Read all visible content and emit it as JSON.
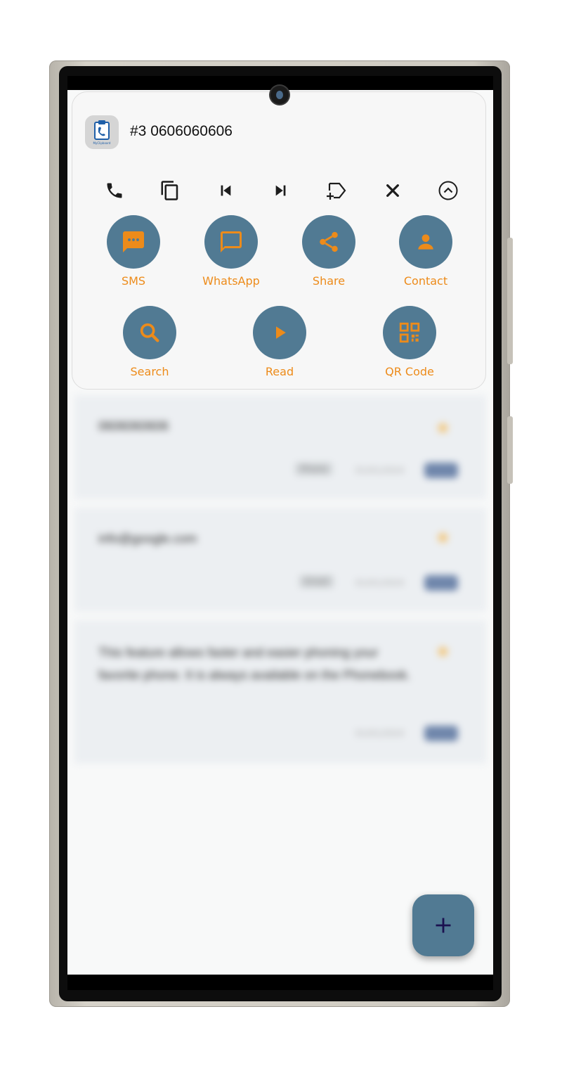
{
  "app": {
    "icon_label": "MyClipboard"
  },
  "header": {
    "title": "#3 0606060606"
  },
  "toolbar": [
    {
      "icon": "phone-icon"
    },
    {
      "icon": "copy-icon"
    },
    {
      "icon": "skip-previous-icon"
    },
    {
      "icon": "skip-next-icon"
    },
    {
      "icon": "add-label-icon"
    },
    {
      "icon": "close-icon"
    },
    {
      "icon": "collapse-up-icon"
    }
  ],
  "actions_row1": [
    {
      "label": "SMS",
      "icon": "sms-icon"
    },
    {
      "label": "WhatsApp",
      "icon": "chat-bubble-icon"
    },
    {
      "label": "Share",
      "icon": "share-icon"
    },
    {
      "label": "Contact",
      "icon": "person-icon"
    }
  ],
  "actions_row2": [
    {
      "label": "Search",
      "icon": "search-icon"
    },
    {
      "label": "Read",
      "icon": "play-icon"
    },
    {
      "label": "QR Code",
      "icon": "qr-code-icon"
    }
  ],
  "list": [
    {
      "text": "0606060606",
      "chip": "Phone",
      "date": "01/01/2024"
    },
    {
      "text": "info@google.com",
      "chip": "Email",
      "date": "01/01/2024"
    },
    {
      "text": "This feature allows faster and easier phoning your favorite phone. It is always available on the Phonebook.",
      "date": "01/01/2024"
    }
  ],
  "fab": {
    "icon": "plus-icon"
  },
  "colors": {
    "accent": "#517a93",
    "label": "#ed8b1a"
  }
}
